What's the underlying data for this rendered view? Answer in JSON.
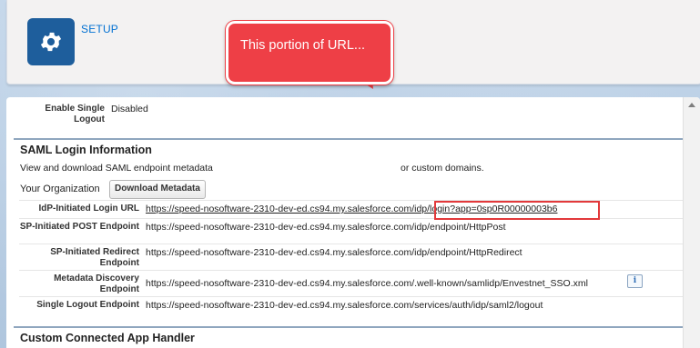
{
  "header": {
    "title": "SETUP",
    "icon": "gear-icon",
    "icon_color": "#1e5e9c"
  },
  "single_logout": {
    "label": "Enable Single Logout",
    "value": "Disabled"
  },
  "saml_section": {
    "title": "SAML Login Information",
    "description_start": "View and download SAML endpoint metadata",
    "description_end": "or custom domains.",
    "org_label": "Your Organization",
    "download_button": "Download Metadata",
    "rows": [
      {
        "label": "IdP-Initiated Login URL",
        "value": "https://speed-nosoftware-2310-dev-ed.cs94.my.salesforce.com/idp/login?app=0sp0R00000003b6"
      },
      {
        "label": "SP-Initiated POST Endpoint",
        "value": "https://speed-nosoftware-2310-dev-ed.cs94.my.salesforce.com/idp/endpoint/HttpPost"
      },
      {
        "label": "SP-Initiated Redirect Endpoint",
        "value": "https://speed-nosoftware-2310-dev-ed.cs94.my.salesforce.com/idp/endpoint/HttpRedirect"
      },
      {
        "label": "Metadata Discovery Endpoint",
        "value": "https://speed-nosoftware-2310-dev-ed.cs94.my.salesforce.com/.well-known/samlidp/Envestnet_SSO.xml"
      },
      {
        "label": "Single Logout Endpoint",
        "value": "https://speed-nosoftware-2310-dev-ed.cs94.my.salesforce.com/services/auth/idp/saml2/logout"
      }
    ]
  },
  "handler_section": {
    "title": "Custom Connected App Handler"
  },
  "callout": {
    "text": "This portion of URL...",
    "color": "#ee3f46"
  },
  "info_icon": "info-icon"
}
